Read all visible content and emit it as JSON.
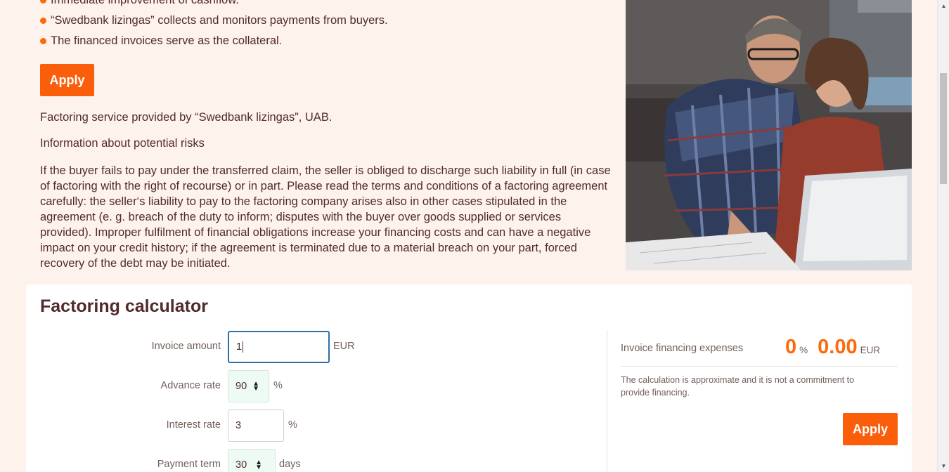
{
  "intro": {
    "bullets": [
      "Immediate improvement of cashflow.",
      "“Swedbank lizingas” collects and monitors payments from buyers.",
      "The financed invoices serve as the collateral."
    ],
    "apply_label": "Apply",
    "provided_text": "Factoring service provided by “Swedbank lizingas”, UAB.",
    "risks_title": "Information about potential risks",
    "risks_text": "If the buyer fails to pay under the transferred claim, the seller is obliged to discharge such liability in full (in case of factoring with the right of recourse) or in part. Please read the terms and conditions of a factoring agreement carefully: the seller‘s liability to pay to the factoring company arises also in other cases stipulated in the agreement (e. g. breach of the duty to inform; disputes with the buyer over goods supplied or services provided). Improper fulfilment of financial obligations increase your financing costs and can have a negative impact on your credit history; if the agreement is terminated due to a material breach on your part, forced recovery of the debt may be initiated."
  },
  "calculator": {
    "title": "Factoring calculator",
    "invoice_amount": {
      "label": "Invoice amount",
      "value": "1",
      "unit": "EUR"
    },
    "advance_rate": {
      "label": "Advance rate",
      "value": "90",
      "unit": "%"
    },
    "interest_rate": {
      "label": "Interest rate",
      "value": "3",
      "unit": "%"
    },
    "payment_term": {
      "label": "Payment term",
      "value": "30",
      "unit": "days"
    },
    "expenses": {
      "label": "Invoice financing expenses",
      "percent_value": "0",
      "percent_unit": "%",
      "amount_value": "0.00",
      "amount_unit": "EUR"
    },
    "note": "The calculation is approximate and it is not a commitment to provide financing.",
    "apply_label": "Apply"
  },
  "colors": {
    "accent": "#fb5e0a",
    "page_background": "#fdf2ec",
    "text": "#512b2b"
  },
  "icons": {
    "bullet": "orange-dot",
    "select_arrows": "updown-arrows",
    "scroll_up": "triangle-up",
    "scroll_down": "triangle-down"
  }
}
